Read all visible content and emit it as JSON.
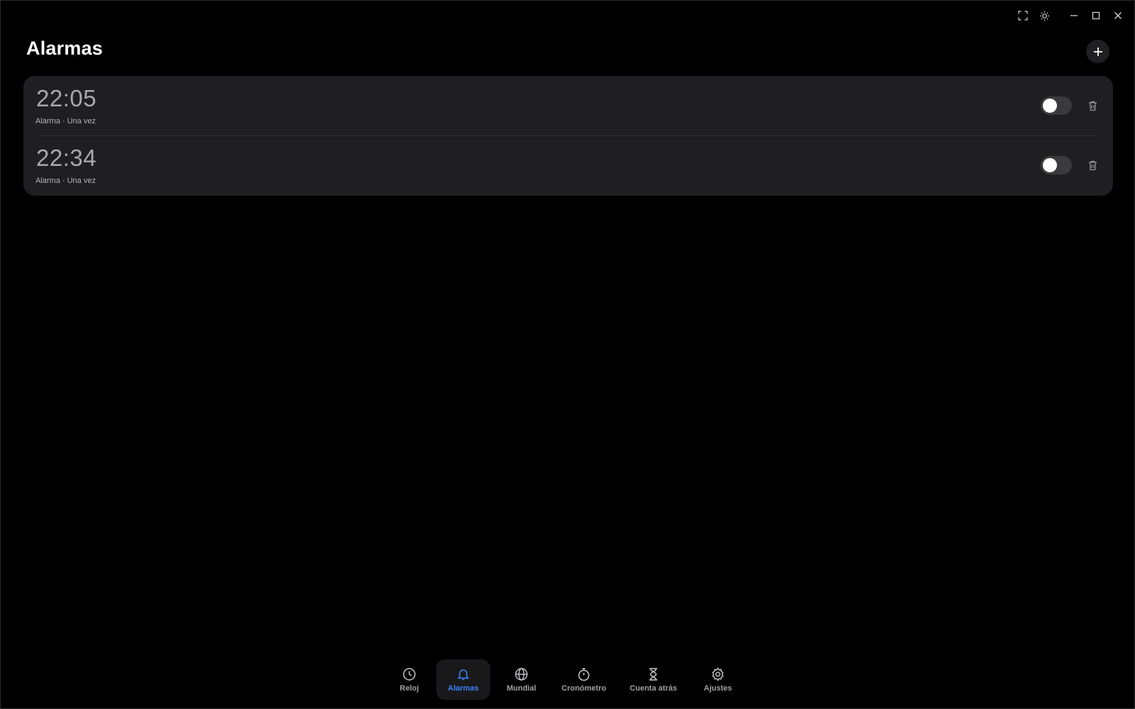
{
  "page": {
    "title": "Alarmas"
  },
  "window_controls": {
    "icons": [
      "fullscreen-icon",
      "brightness-icon",
      "minimize-icon",
      "maximize-icon",
      "close-icon"
    ]
  },
  "alarms": [
    {
      "time": "22:05",
      "subtitle": "Alarma · Una vez",
      "enabled": false
    },
    {
      "time": "22:34",
      "subtitle": "Alarma · Una vez",
      "enabled": false
    }
  ],
  "nav": {
    "items": [
      {
        "label": "Reloj",
        "icon": "clock-icon",
        "active": false
      },
      {
        "label": "Alarmas",
        "icon": "bell-icon",
        "active": true
      },
      {
        "label": "Mundial",
        "icon": "globe-icon",
        "active": false
      },
      {
        "label": "Cronómetro",
        "icon": "stopwatch-icon",
        "active": false
      },
      {
        "label": "Cuenta atrás",
        "icon": "hourglass-icon",
        "active": false
      },
      {
        "label": "Ajustes",
        "icon": "gear-icon",
        "active": false
      }
    ]
  },
  "colors": {
    "background": "#000000",
    "card": "#1f1f21",
    "accent": "#3b82f6",
    "text_muted": "#a9a9ad"
  }
}
